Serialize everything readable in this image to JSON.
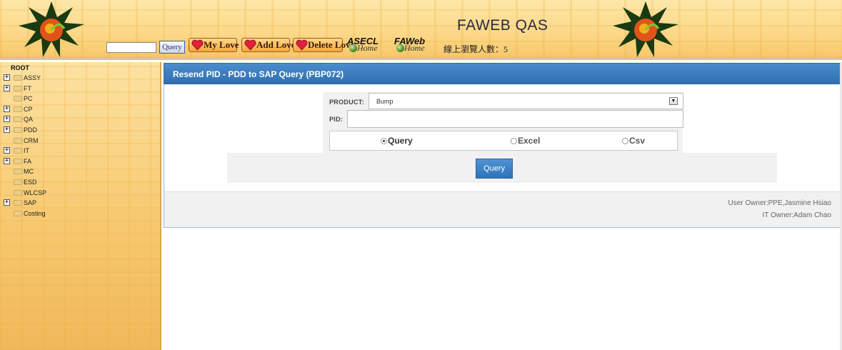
{
  "header": {
    "app_title": "FAWEB QAS",
    "search_value": "",
    "query_label": "Query",
    "my_love_label": "My Love",
    "add_love_label": "Add Love",
    "delete_love_label": "Delete Love",
    "asecl_label": "ASECL",
    "faweb_label": "FAWeb",
    "home_label": "Home",
    "online_count": "線上瀏覽人數：5"
  },
  "sidebar": {
    "root": "ROOT",
    "items": [
      {
        "label": "ASSY",
        "expandable": true
      },
      {
        "label": "FT",
        "expandable": true
      },
      {
        "label": "PC",
        "expandable": false
      },
      {
        "label": "CP",
        "expandable": true
      },
      {
        "label": "QA",
        "expandable": true
      },
      {
        "label": "PDD",
        "expandable": true
      },
      {
        "label": "CRM",
        "expandable": false
      },
      {
        "label": "IT",
        "expandable": true
      },
      {
        "label": "FA",
        "expandable": true
      },
      {
        "label": "MC",
        "expandable": false
      },
      {
        "label": "ESD",
        "expandable": false
      },
      {
        "label": "WLCSP",
        "expandable": false
      },
      {
        "label": "SAP",
        "expandable": true
      },
      {
        "label": "Costing",
        "expandable": false
      }
    ]
  },
  "panel": {
    "title": "Resend PID - PDD to SAP Query (PBP072)",
    "product_label": "PRODUCT:",
    "product_value": "Bump",
    "pid_label": "PID:",
    "pid_value": "",
    "radios": [
      {
        "label": "Query",
        "checked": true
      },
      {
        "label": "Excel",
        "checked": false
      },
      {
        "label": "Csv",
        "checked": false
      }
    ],
    "query_button": "Query",
    "user_owner": "User Owner:PPE,Jasmine Hsiao",
    "it_owner": "IT Owner:Adam Chao"
  },
  "colors": {
    "panel_header": "#3a7cbf",
    "sidebar_bg": "#f6c76a",
    "header_bg": "#fcd98a"
  }
}
